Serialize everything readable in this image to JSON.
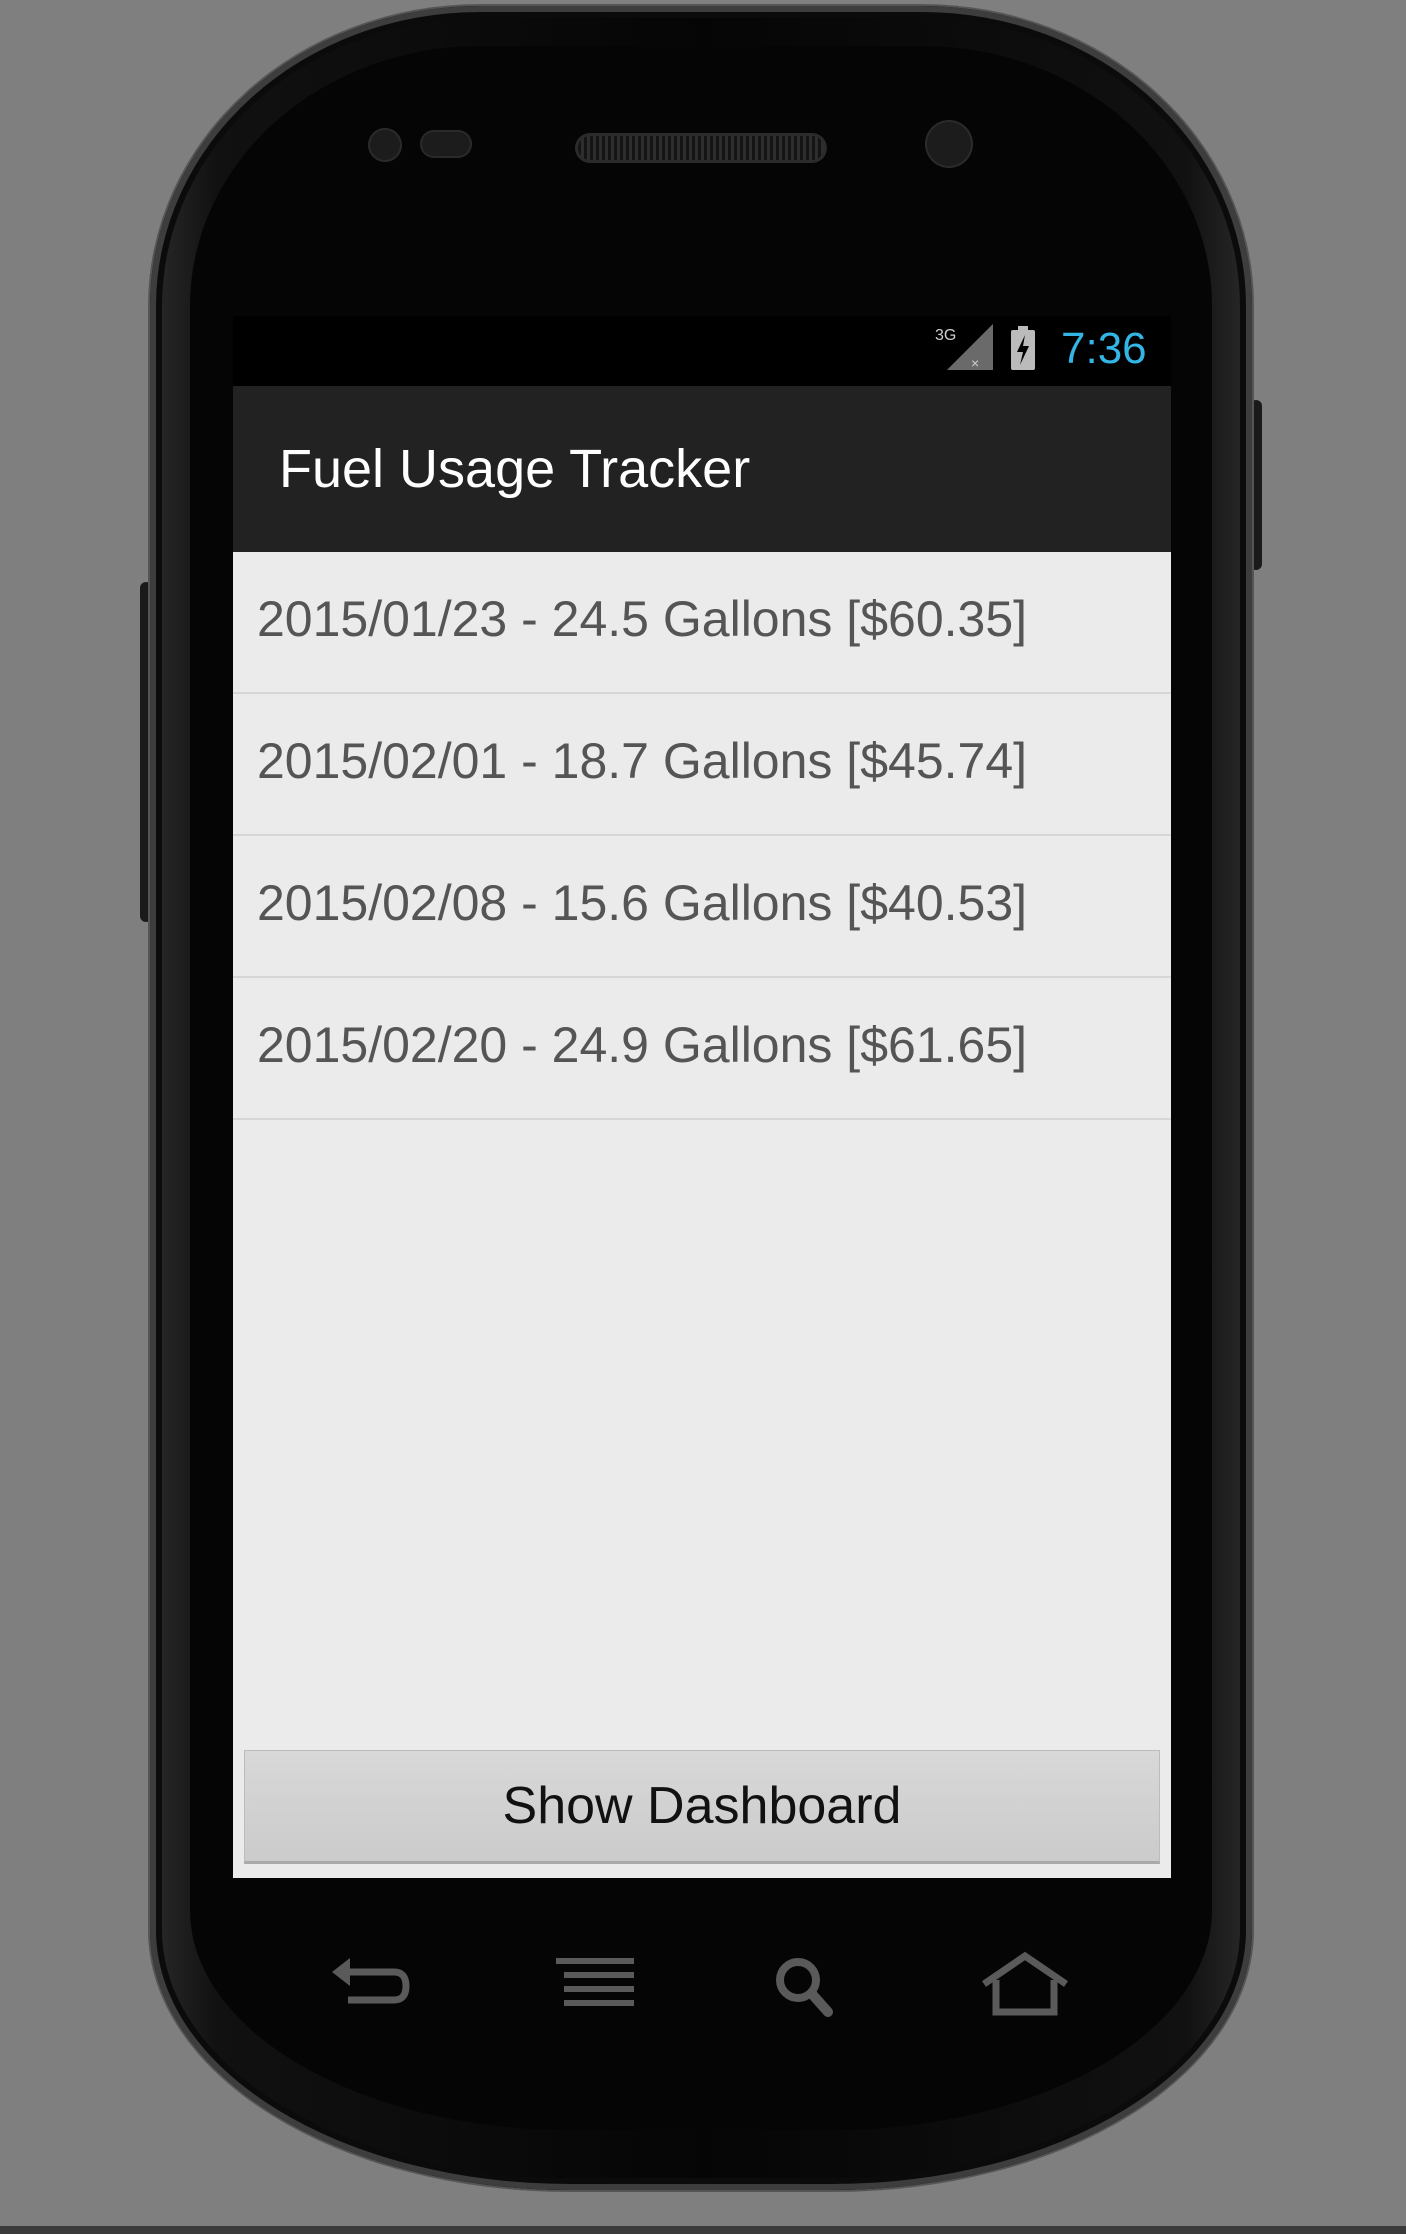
{
  "status_bar": {
    "network": "3G",
    "time": "7:36",
    "icons": [
      "signal-3g-icon",
      "battery-charging-icon"
    ]
  },
  "action_bar": {
    "title": "Fuel Usage Tracker"
  },
  "fuel_entries": [
    {
      "label": "2015/01/23 - 24.5 Gallons [$60.35]"
    },
    {
      "label": "2015/02/01 - 18.7 Gallons [$45.74]"
    },
    {
      "label": "2015/02/08 - 15.6 Gallons [$40.53]"
    },
    {
      "label": "2015/02/20 - 24.9 Gallons [$61.65]"
    }
  ],
  "buttons": {
    "show_dashboard": "Show Dashboard"
  },
  "nav_keys": [
    "back-icon",
    "menu-icon",
    "search-icon",
    "home-icon"
  ],
  "colors": {
    "clock": "#33b5e5",
    "action_bar": "#222222",
    "screen_bg": "#ebebeb"
  }
}
